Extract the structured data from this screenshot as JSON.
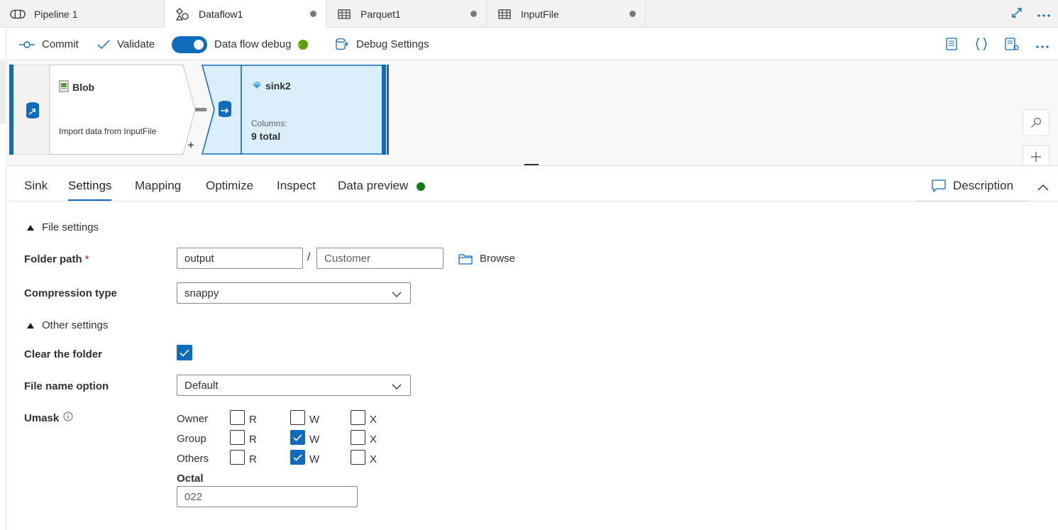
{
  "tabs": [
    {
      "label": "Pipeline 1",
      "icon": "pipeline-icon",
      "dirty": false
    },
    {
      "label": "Dataflow1",
      "icon": "dataflow-icon",
      "dirty": true
    },
    {
      "label": "Parquet1",
      "icon": "table-icon",
      "dirty": true
    },
    {
      "label": "InputFile",
      "icon": "table-icon",
      "dirty": true
    }
  ],
  "toolbar": {
    "commit": "Commit",
    "validate": "Validate",
    "debug_toggle": "Data flow debug",
    "debug_settings": "Debug Settings"
  },
  "canvas": {
    "source": {
      "title": "Blob",
      "subtitle": "Import data from InputFile"
    },
    "sink": {
      "title": "sink2",
      "columns_label": "Columns:",
      "columns_value": "9 total"
    },
    "add_symbol": "+"
  },
  "pane_tabs": [
    "Sink",
    "Settings",
    "Mapping",
    "Optimize",
    "Inspect",
    "Data preview"
  ],
  "active_tab": "Settings",
  "description_label": "Description",
  "file_settings": {
    "section": "File settings",
    "folder_path_label": "Folder path",
    "required_mark": "*",
    "container": "output",
    "directory_placeholder": "Customer",
    "slash": "/",
    "browse": "Browse",
    "compression_label": "Compression type",
    "compression_value": "snappy"
  },
  "other_settings": {
    "section": "Other settings",
    "clear_folder_label": "Clear the folder",
    "clear_folder_checked": true,
    "file_name_label": "File name option",
    "file_name_value": "Default",
    "umask_label": "Umask",
    "umask_rows": [
      {
        "name": "Owner",
        "r": false,
        "w": false,
        "x": false
      },
      {
        "name": "Group",
        "r": false,
        "w": true,
        "x": false
      },
      {
        "name": "Others",
        "r": false,
        "w": true,
        "x": false
      }
    ],
    "perm_labels": {
      "r": "R",
      "w": "W",
      "x": "X"
    },
    "octal_label": "Octal",
    "octal_value": "022"
  },
  "colors": {
    "accent": "#0f6cbd",
    "success": "#57a300",
    "sink_fill": "#dbeefb"
  }
}
